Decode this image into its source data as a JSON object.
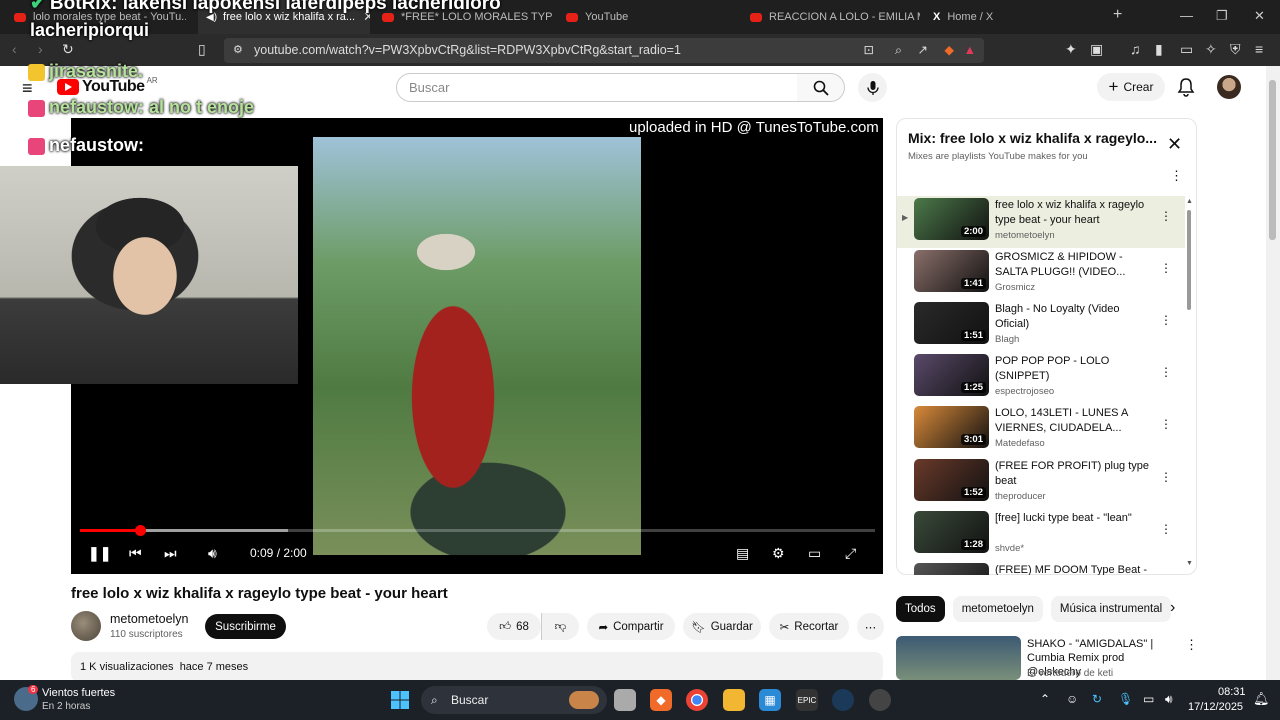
{
  "browser": {
    "tabs": [
      {
        "label": "lolo morales type beat - YouTu..."
      },
      {
        "label": "free lolo x wiz khalifa x ra..."
      },
      {
        "label": "*FREE* LOLO MORALES TYPE BE..."
      },
      {
        "label": "YouTube"
      },
      {
        "label": "REACCION A LOLO - EMILIA ME..."
      },
      {
        "label": "Home / X"
      }
    ],
    "url": "youtube.com/watch?v=PW3XpbvCtRg&list=RDPW3XpbvCtRg&start_radio=1"
  },
  "header": {
    "logo_text": "YouTube",
    "country": "AR",
    "search_placeholder": "Buscar",
    "create_label": "Crear"
  },
  "stream_overlay": {
    "top_line": "BotRix: lakensi lapokensi laferdipeps lacheridioro",
    "chat": [
      {
        "text": "lacheripiorqui",
        "dim": false
      },
      {
        "text": "jirasasnite.",
        "dim": true
      },
      {
        "text": "nefaustow: al no t enoje",
        "dim": true
      },
      {
        "text": "nefaustow:",
        "dim": false
      }
    ]
  },
  "player": {
    "watermark": "uploaded in HD @ TunesToTube.com",
    "time_display": "0:09 / 2:00",
    "progress_fraction": 0.075
  },
  "video": {
    "title": "free lolo x wiz khalifa x rageylo type beat - your heart",
    "channel": "metometoelyn",
    "subscribers": "110 suscriptores",
    "subscribe_label": "Suscribirme",
    "likes": "68",
    "share_label": "Compartir",
    "save_label": "Guardar",
    "clip_label": "Recortar",
    "views": "1 K visualizaciones",
    "age": "hace 7 meses"
  },
  "playlist": {
    "title": "Mix: free lolo x wiz khalifa x rageylo...",
    "subtitle": "Mixes are playlists YouTube makes for you",
    "items": [
      {
        "title": "free lolo x wiz khalifa x rageylo type beat - your heart",
        "channel": "metometoelyn",
        "duration": "2:00",
        "color": "#4c7a4a"
      },
      {
        "title": "GROSMICZ & HIPIDOW - SALTA PLUGG!! (VIDEO...",
        "channel": "Grosmicz",
        "duration": "1:41",
        "color": "#8a6f6a"
      },
      {
        "title": "Blagh - No Loyalty (Video Oficial)",
        "channel": "Blagh",
        "duration": "1:51",
        "color": "#2a2a2a"
      },
      {
        "title": "POP POP POP - LOLO (SNIPPET)",
        "channel": "espectrojoseo",
        "duration": "1:25",
        "color": "#5a4a6a"
      },
      {
        "title": "LOLO, 143LETI - LUNES A VIERNES, CIUDADELA...",
        "channel": "Matedefaso",
        "duration": "3:01",
        "color": "#d98a3a"
      },
      {
        "title": "(FREE FOR PROFIT) plug type beat",
        "channel": "theproducer",
        "duration": "1:52",
        "color": "#6a3a2a"
      },
      {
        "title": "[free] lucki type beat - \"lean\"",
        "channel": "shvde*",
        "duration": "1:28",
        "color": "#3a4a3a"
      },
      {
        "title": "(FREE) MF DOOM Type Beat -",
        "channel": "",
        "duration": "",
        "color": "#555555"
      }
    ]
  },
  "chips": [
    "Todos",
    "metometoelyn",
    "Música instrumental"
  ],
  "recommended": {
    "title": "SHAKO - \"AMIGDALAS\" | Cumbia Remix prod @elskechy",
    "channel": "El vertedero de keti"
  },
  "taskbar": {
    "weather_title": "Vientos fuertes",
    "weather_sub": "En 2 horas",
    "weather_badge": "6",
    "search_label": "Buscar",
    "time": "08:31",
    "date": "17/12/2025"
  }
}
